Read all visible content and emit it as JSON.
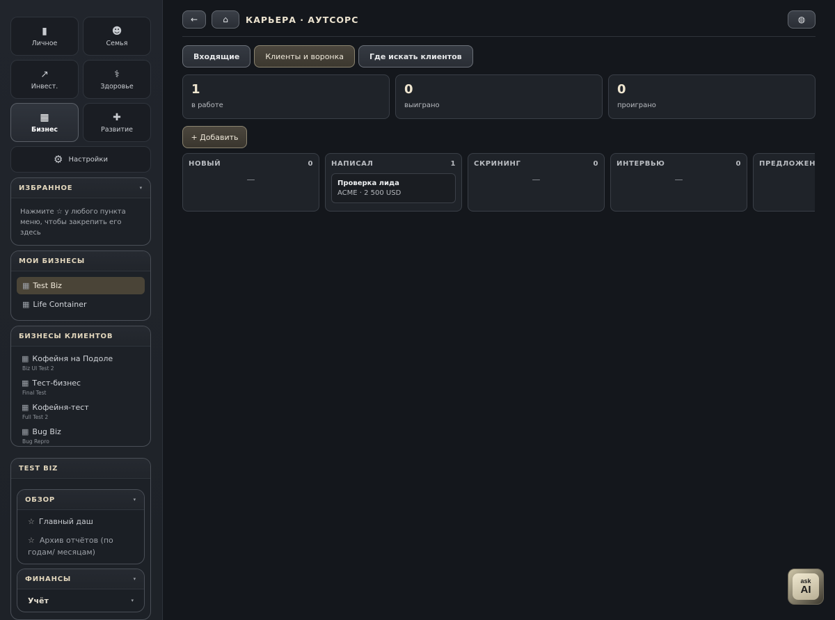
{
  "sidebar": {
    "tiles": [
      {
        "label": "Личное",
        "icon": "wallet-icon",
        "glyph": "▮"
      },
      {
        "label": "Семья",
        "icon": "family-icon",
        "glyph": "☻"
      },
      {
        "label": "Инвест.",
        "icon": "chart-icon",
        "glyph": "↗"
      },
      {
        "label": "Здоровье",
        "icon": "stethoscope-icon",
        "glyph": "⚕"
      },
      {
        "label": "Бизнес",
        "icon": "building-icon",
        "glyph": "▦"
      },
      {
        "label": "Развитие",
        "icon": "gamepad-icon",
        "glyph": "✚"
      }
    ],
    "settings": {
      "label": "Настройки",
      "icon": "gear-icon",
      "glyph": "⚙"
    },
    "favorites": {
      "title": "ИЗБРАННОЕ",
      "hint": "Нажмите ☆ у любого пункта меню, чтобы закрепить его здесь"
    },
    "my_businesses": {
      "title": "МОИ БИЗНЕСЫ",
      "items": [
        {
          "label": "Test Biz"
        },
        {
          "label": "Life Container"
        }
      ]
    },
    "client_businesses": {
      "title": "БИЗНЕСЫ КЛИЕНТОВ",
      "items": [
        {
          "label": "Кофейня на Подоле",
          "sub": "Biz UI Test 2"
        },
        {
          "label": "Тест-бизнес",
          "sub": "Final Test"
        },
        {
          "label": "Кофейня-тест",
          "sub": "Full Test 2"
        },
        {
          "label": "Bug Biz",
          "sub": "Bug Repro"
        }
      ]
    },
    "current_biz": {
      "title": "TEST BIZ",
      "overview": {
        "title": "ОБЗОР",
        "links": [
          {
            "label": "Главный даш"
          },
          {
            "label": "Архив отчётов (по годам/ месяцам)"
          }
        ]
      },
      "finance": {
        "title": "ФИНАНСЫ",
        "uchet": "Учёт"
      }
    },
    "star_glyph": "☆",
    "caret_glyph": "▾",
    "biz_glyph": "▦"
  },
  "header": {
    "back_glyph": "←",
    "home_glyph": "⌂",
    "title": "КАРЬЕРА · АУТСОРС",
    "globe_glyph": "◍"
  },
  "tabs": [
    {
      "label": "Входящие"
    },
    {
      "label": "Клиенты и воронка"
    },
    {
      "label": "Где искать клиентов"
    }
  ],
  "stats": [
    {
      "value": "1",
      "label": "в работе"
    },
    {
      "value": "0",
      "label": "выиграно"
    },
    {
      "value": "0",
      "label": "проиграно"
    }
  ],
  "add_button": "+ Добавить",
  "board": {
    "empty": "—",
    "columns": [
      {
        "title": "НОВЫЙ",
        "count": "0"
      },
      {
        "title": "НАПИСАЛ",
        "count": "1",
        "card": {
          "title": "Проверка лида",
          "meta": "ACME · 2 500 USD"
        }
      },
      {
        "title": "СКРИНИНГ",
        "count": "0"
      },
      {
        "title": "ИНТЕРВЬЮ",
        "count": "0"
      },
      {
        "title": "ПРЕДЛОЖЕНИЕ",
        "count": ""
      }
    ]
  },
  "ask_ai": {
    "line1": "ask",
    "line2": "AI"
  }
}
